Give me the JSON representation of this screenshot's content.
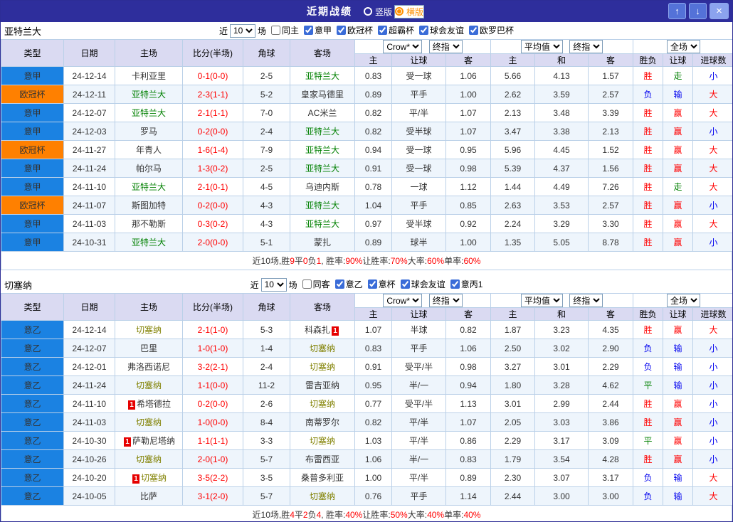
{
  "topbar": {
    "title": "近期战绩",
    "vertical_label": "竖版",
    "horizontal_label": "横版",
    "up_icon": "↑",
    "down_icon": "↓",
    "close_icon": "×"
  },
  "filter_labels": {
    "near": "近",
    "games": "场"
  },
  "dropdowns": {
    "count": "10",
    "company": "Crow*",
    "final": "终指",
    "average": "平均值",
    "scope": "全场"
  },
  "columns": {
    "type": "类型",
    "date": "日期",
    "home": "主场",
    "score": "比分(半场)",
    "corner": "角球",
    "away": "客场",
    "h": "主",
    "handicap": "让球",
    "a": "客",
    "avg_h": "主",
    "draw": "和",
    "avg_a": "客",
    "result": "胜负",
    "let_col": "让球",
    "goals": "进球数"
  },
  "colors": {
    "league_default": "#1b82e2",
    "league_colors": {
      "意甲": "#1b82e2",
      "意乙": "#1b82e2",
      "欧冠杯": "#ff8000"
    },
    "result_colors": {
      "胜": "#ff0000",
      "负": "#0000ee",
      "平": "#008000"
    },
    "let_colors": {
      "赢": "#ff0000",
      "输": "#0000ee",
      "走": "#008000"
    },
    "goal_colors": {
      "大": "#ff0000",
      "小": "#0000ee"
    },
    "score": "#ff0000"
  },
  "sections": [
    {
      "team": "亚特兰大",
      "team_color": "#008000",
      "filter": {
        "checks": [
          {
            "label": "同主",
            "checked": false
          },
          {
            "label": "意甲",
            "checked": true
          },
          {
            "label": "欧冠杯",
            "checked": true
          },
          {
            "label": "超霸杯",
            "checked": true
          },
          {
            "label": "球会友谊",
            "checked": true
          },
          {
            "label": "欧罗巴杯",
            "checked": true
          }
        ]
      },
      "rows": [
        {
          "league": "意甲",
          "date": "24-12-14",
          "home": "卡利亚里",
          "home_hl": false,
          "score": "0-1(0-0)",
          "corner": "2-5",
          "away": "亚特兰大",
          "away_hl": true,
          "odds": [
            "0.83",
            "受一球",
            "1.06",
            "5.66",
            "4.13",
            "1.57"
          ],
          "result": "胜",
          "let": "走",
          "goals": "小"
        },
        {
          "league": "欧冠杯",
          "date": "24-12-11",
          "home": "亚特兰大",
          "home_hl": true,
          "score": "2-3(1-1)",
          "corner": "5-2",
          "away": "皇家马德里",
          "away_hl": false,
          "odds": [
            "0.89",
            "平手",
            "1.00",
            "2.62",
            "3.59",
            "2.57"
          ],
          "result": "负",
          "let": "输",
          "goals": "大"
        },
        {
          "league": "意甲",
          "date": "24-12-07",
          "home": "亚特兰大",
          "home_hl": true,
          "score": "2-1(1-1)",
          "corner": "7-0",
          "away": "AC米兰",
          "away_hl": false,
          "odds": [
            "0.82",
            "平/半",
            "1.07",
            "2.13",
            "3.48",
            "3.39"
          ],
          "result": "胜",
          "let": "赢",
          "goals": "大"
        },
        {
          "league": "意甲",
          "date": "24-12-03",
          "home": "罗马",
          "home_hl": false,
          "score": "0-2(0-0)",
          "corner": "2-4",
          "away": "亚特兰大",
          "away_hl": true,
          "odds": [
            "0.82",
            "受半球",
            "1.07",
            "3.47",
            "3.38",
            "2.13"
          ],
          "result": "胜",
          "let": "赢",
          "goals": "小"
        },
        {
          "league": "欧冠杯",
          "date": "24-11-27",
          "home": "年青人",
          "home_hl": false,
          "score": "1-6(1-4)",
          "corner": "7-9",
          "away": "亚特兰大",
          "away_hl": true,
          "odds": [
            "0.94",
            "受一球",
            "0.95",
            "5.96",
            "4.45",
            "1.52"
          ],
          "result": "胜",
          "let": "赢",
          "goals": "大"
        },
        {
          "league": "意甲",
          "date": "24-11-24",
          "home": "帕尔马",
          "home_hl": false,
          "score": "1-3(0-2)",
          "corner": "2-5",
          "away": "亚特兰大",
          "away_hl": true,
          "odds": [
            "0.91",
            "受一球",
            "0.98",
            "5.39",
            "4.37",
            "1.56"
          ],
          "result": "胜",
          "let": "赢",
          "goals": "大"
        },
        {
          "league": "意甲",
          "date": "24-11-10",
          "home": "亚特兰大",
          "home_hl": true,
          "score": "2-1(0-1)",
          "corner": "4-5",
          "away": "乌迪内斯",
          "away_hl": false,
          "odds": [
            "0.78",
            "一球",
            "1.12",
            "1.44",
            "4.49",
            "7.26"
          ],
          "result": "胜",
          "let": "走",
          "goals": "大"
        },
        {
          "league": "欧冠杯",
          "date": "24-11-07",
          "home": "斯图加特",
          "home_hl": false,
          "score": "0-2(0-0)",
          "corner": "4-3",
          "away": "亚特兰大",
          "away_hl": true,
          "odds": [
            "1.04",
            "平手",
            "0.85",
            "2.63",
            "3.53",
            "2.57"
          ],
          "result": "胜",
          "let": "赢",
          "goals": "小"
        },
        {
          "league": "意甲",
          "date": "24-11-03",
          "home": "那不勒斯",
          "home_hl": false,
          "score": "0-3(0-2)",
          "corner": "4-3",
          "away": "亚特兰大",
          "away_hl": true,
          "odds": [
            "0.97",
            "受半球",
            "0.92",
            "2.24",
            "3.29",
            "3.30"
          ],
          "result": "胜",
          "let": "赢",
          "goals": "大"
        },
        {
          "league": "意甲",
          "date": "24-10-31",
          "home": "亚特兰大",
          "home_hl": true,
          "score": "2-0(0-0)",
          "corner": "5-1",
          "away": "蒙扎",
          "away_hl": false,
          "odds": [
            "0.89",
            "球半",
            "1.00",
            "1.35",
            "5.05",
            "8.78"
          ],
          "result": "胜",
          "let": "赢",
          "goals": "小"
        }
      ],
      "summary": [
        {
          "t": "近10场,胜",
          "c": "#333333"
        },
        {
          "t": "9",
          "c": "#ff0000"
        },
        {
          "t": "平",
          "c": "#333333"
        },
        {
          "t": "0",
          "c": "#ff0000"
        },
        {
          "t": "负",
          "c": "#333333"
        },
        {
          "t": "1",
          "c": "#ff0000"
        },
        {
          "t": ", 胜率:",
          "c": "#333333"
        },
        {
          "t": "90%",
          "c": "#ff0000"
        },
        {
          "t": " 让胜率:",
          "c": "#333333"
        },
        {
          "t": "70%",
          "c": "#ff0000"
        },
        {
          "t": " 大率:",
          "c": "#333333"
        },
        {
          "t": "60%",
          "c": "#ff0000"
        },
        {
          "t": " 单率:",
          "c": "#333333"
        },
        {
          "t": "60%",
          "c": "#ff0000"
        }
      ]
    },
    {
      "team": "切塞纳",
      "team_color": "#808000",
      "filter": {
        "checks": [
          {
            "label": "同客",
            "checked": false
          },
          {
            "label": "意乙",
            "checked": true
          },
          {
            "label": "意杯",
            "checked": true
          },
          {
            "label": "球会友谊",
            "checked": true
          },
          {
            "label": "意丙1",
            "checked": true
          }
        ]
      },
      "rows": [
        {
          "league": "意乙",
          "date": "24-12-14",
          "home": "切塞纳",
          "home_hl": true,
          "score": "2-1(1-0)",
          "corner": "5-3",
          "away": "科森扎",
          "away_hl": false,
          "away_card": "after",
          "odds": [
            "1.07",
            "半球",
            "0.82",
            "1.87",
            "3.23",
            "4.35"
          ],
          "result": "胜",
          "let": "赢",
          "goals": "大"
        },
        {
          "league": "意乙",
          "date": "24-12-07",
          "home": "巴里",
          "home_hl": false,
          "score": "1-0(1-0)",
          "corner": "1-4",
          "away": "切塞纳",
          "away_hl": true,
          "odds": [
            "0.83",
            "平手",
            "1.06",
            "2.50",
            "3.02",
            "2.90"
          ],
          "result": "负",
          "let": "输",
          "goals": "小"
        },
        {
          "league": "意乙",
          "date": "24-12-01",
          "home": "弗洛西诺尼",
          "home_hl": false,
          "score": "3-2(2-1)",
          "corner": "2-4",
          "away": "切塞纳",
          "away_hl": true,
          "odds": [
            "0.91",
            "受平/半",
            "0.98",
            "3.27",
            "3.01",
            "2.29"
          ],
          "result": "负",
          "let": "输",
          "goals": "小"
        },
        {
          "league": "意乙",
          "date": "24-11-24",
          "home": "切塞纳",
          "home_hl": true,
          "score": "1-1(0-0)",
          "corner": "11-2",
          "away": "雷吉亚纳",
          "away_hl": false,
          "odds": [
            "0.95",
            "半/一",
            "0.94",
            "1.80",
            "3.28",
            "4.62"
          ],
          "result": "平",
          "let": "输",
          "goals": "小"
        },
        {
          "league": "意乙",
          "date": "24-11-10",
          "home": "希塔德拉",
          "home_hl": false,
          "home_card": "before",
          "score": "0-2(0-0)",
          "corner": "2-6",
          "away": "切塞纳",
          "away_hl": true,
          "odds": [
            "0.77",
            "受平/半",
            "1.13",
            "3.01",
            "2.99",
            "2.44"
          ],
          "result": "胜",
          "let": "赢",
          "goals": "小"
        },
        {
          "league": "意乙",
          "date": "24-11-03",
          "home": "切塞纳",
          "home_hl": true,
          "score": "1-0(0-0)",
          "corner": "8-4",
          "away": "南蒂罗尔",
          "away_hl": false,
          "odds": [
            "0.82",
            "平/半",
            "1.07",
            "2.05",
            "3.03",
            "3.86"
          ],
          "result": "胜",
          "let": "赢",
          "goals": "小"
        },
        {
          "league": "意乙",
          "date": "24-10-30",
          "home": "萨勒尼塔纳",
          "home_hl": false,
          "home_card": "before",
          "score": "1-1(1-1)",
          "corner": "3-3",
          "away": "切塞纳",
          "away_hl": true,
          "odds": [
            "1.03",
            "平/半",
            "0.86",
            "2.29",
            "3.17",
            "3.09"
          ],
          "result": "平",
          "let": "赢",
          "goals": "小"
        },
        {
          "league": "意乙",
          "date": "24-10-26",
          "home": "切塞纳",
          "home_hl": true,
          "score": "2-0(1-0)",
          "corner": "5-7",
          "away": "布雷西亚",
          "away_hl": false,
          "odds": [
            "1.06",
            "半/一",
            "0.83",
            "1.79",
            "3.54",
            "4.28"
          ],
          "result": "胜",
          "let": "赢",
          "goals": "小"
        },
        {
          "league": "意乙",
          "date": "24-10-20",
          "home": "切塞纳",
          "home_hl": true,
          "home_card": "before",
          "score": "3-5(2-2)",
          "corner": "3-5",
          "away": "桑普多利亚",
          "away_hl": false,
          "odds": [
            "1.00",
            "平/半",
            "0.89",
            "2.30",
            "3.07",
            "3.17"
          ],
          "result": "负",
          "let": "输",
          "goals": "大"
        },
        {
          "league": "意乙",
          "date": "24-10-05",
          "home": "比萨",
          "home_hl": false,
          "score": "3-1(2-0)",
          "corner": "5-7",
          "away": "切塞纳",
          "away_hl": true,
          "odds": [
            "0.76",
            "平手",
            "1.14",
            "2.44",
            "3.00",
            "3.00"
          ],
          "result": "负",
          "let": "输",
          "goals": "大"
        }
      ],
      "summary": [
        {
          "t": "近10场,胜",
          "c": "#333333"
        },
        {
          "t": "4",
          "c": "#ff0000"
        },
        {
          "t": "平",
          "c": "#333333"
        },
        {
          "t": "2",
          "c": "#ff0000"
        },
        {
          "t": "负",
          "c": "#333333"
        },
        {
          "t": "4",
          "c": "#ff0000"
        },
        {
          "t": ", 胜率:",
          "c": "#333333"
        },
        {
          "t": "40%",
          "c": "#ff0000"
        },
        {
          "t": " 让胜率:",
          "c": "#333333"
        },
        {
          "t": "50%",
          "c": "#ff0000"
        },
        {
          "t": " 大率:",
          "c": "#333333"
        },
        {
          "t": "40%",
          "c": "#ff0000"
        },
        {
          "t": " 单率:",
          "c": "#333333"
        },
        {
          "t": "40%",
          "c": "#ff0000"
        }
      ]
    }
  ]
}
